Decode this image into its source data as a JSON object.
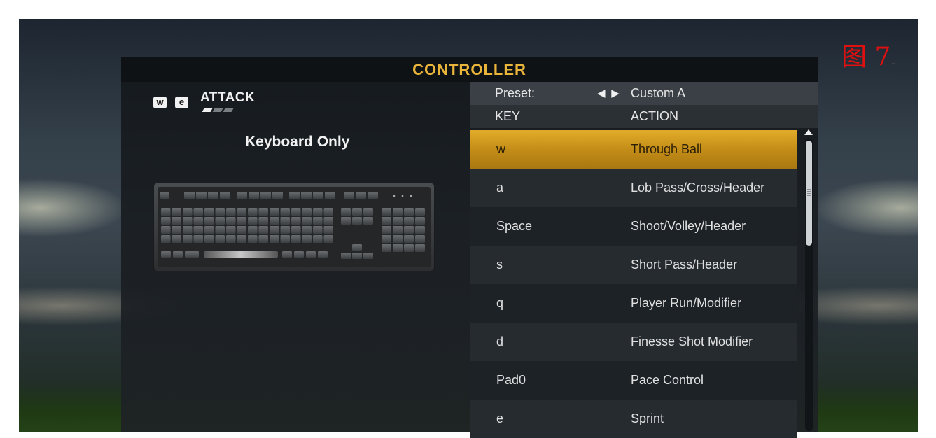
{
  "figure_label": "图 7",
  "figure_label_mark": "↵",
  "panel": {
    "title": "CONTROLLER"
  },
  "mode": {
    "key_left": "w",
    "key_right": "e",
    "title": "ATTACK",
    "page_indicator": {
      "total": 3,
      "active": 1
    },
    "subtitle": "Keyboard Only"
  },
  "preset": {
    "label": "Preset:",
    "arrows": "◀ ▶",
    "value": "Custom A"
  },
  "columns": {
    "key": "KEY",
    "action": "ACTION"
  },
  "bindings": [
    {
      "key": "w",
      "action": "Through Ball",
      "selected": true
    },
    {
      "key": "a",
      "action": "Lob Pass/Cross/Header"
    },
    {
      "key": "Space",
      "action": "Shoot/Volley/Header"
    },
    {
      "key": "s",
      "action": "Short Pass/Header"
    },
    {
      "key": "q",
      "action": "Player Run/Modifier"
    },
    {
      "key": "d",
      "action": "Finesse Shot Modifier"
    },
    {
      "key": "Pad0",
      "action": "Pace Control"
    },
    {
      "key": "e",
      "action": "Sprint"
    }
  ],
  "colors": {
    "title_gold": "#e8b43a",
    "selected_row": "#d4a021",
    "figure_label_red": "#e01010"
  },
  "icons": {
    "preset_left": "triangle-left",
    "preset_right": "triangle-right",
    "scroll_up": "triangle-up"
  },
  "scroll": {
    "visible_fraction": 0.36,
    "position_fraction": 0.0
  }
}
